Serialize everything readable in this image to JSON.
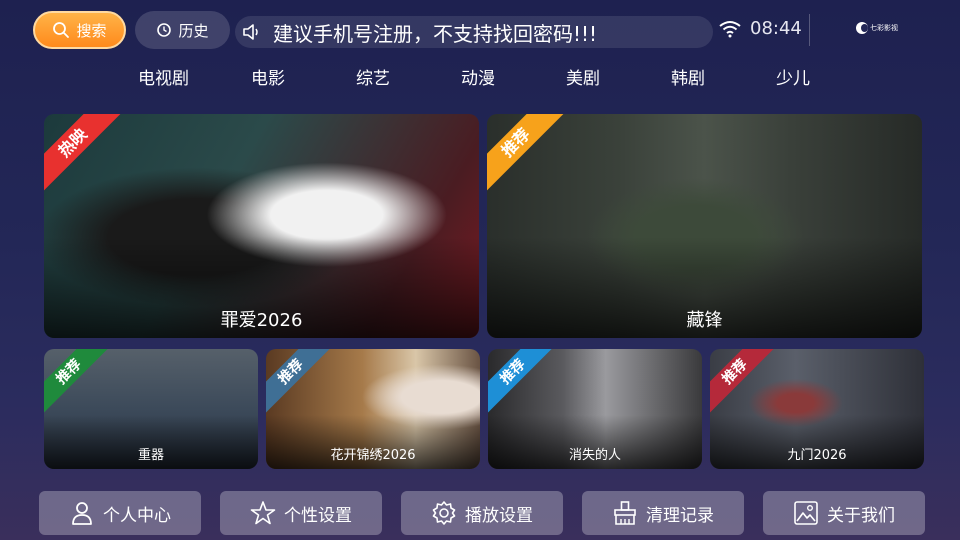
{
  "topbar": {
    "search_label": "搜索",
    "history_label": "历史",
    "notice": "建议手机号注册，不支持找回密码!!!",
    "time": "08:44",
    "logo_text": "七彩影视"
  },
  "tabs": [
    "电视剧",
    "电影",
    "综艺",
    "动漫",
    "美剧",
    "韩剧",
    "少儿"
  ],
  "featured": [
    {
      "title": "罪爱2026",
      "badge": "热映",
      "badge_color": "#e8312f"
    },
    {
      "title": "藏锋",
      "badge": "推荐",
      "badge_color": "#f7a21b"
    }
  ],
  "recommended": [
    {
      "title": "重器",
      "badge": "推荐",
      "badge_color": "#1f8a3c"
    },
    {
      "title": "花开锦绣2026",
      "badge": "推荐",
      "badge_color": "#3f6f95"
    },
    {
      "title": "消失的人",
      "badge": "推荐",
      "badge_color": "#1e8fd6"
    },
    {
      "title": "九门2026",
      "badge": "推荐",
      "badge_color": "#b5293a"
    }
  ],
  "bottom_menu": [
    {
      "label": "个人中心",
      "icon": "person-icon"
    },
    {
      "label": "个性设置",
      "icon": "star-icon"
    },
    {
      "label": "播放设置",
      "icon": "gear-icon"
    },
    {
      "label": "清理记录",
      "icon": "broom-icon"
    },
    {
      "label": "关于我们",
      "icon": "image-icon"
    }
  ],
  "colors": {
    "accent": "#ff9a2e",
    "background": "#232757"
  }
}
